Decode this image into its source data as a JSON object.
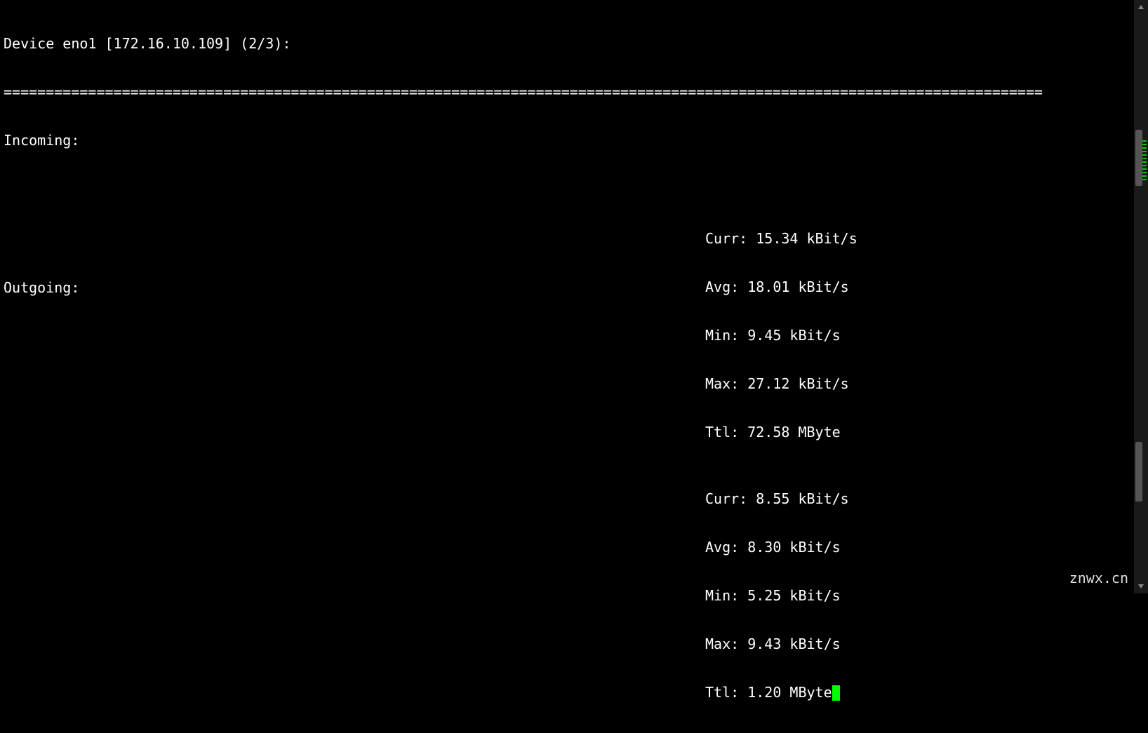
{
  "header": {
    "line": "Device eno1 [172.16.10.109] (2/3):",
    "divider": "==================================================================================================================================="
  },
  "incoming": {
    "label": "Incoming:",
    "stats": {
      "curr": "Curr: 15.34 kBit/s",
      "avg": "Avg: 18.01 kBit/s",
      "min": "Min: 9.45 kBit/s",
      "max": "Max: 27.12 kBit/s",
      "ttl": "Ttl: 72.58 MByte"
    }
  },
  "outgoing": {
    "label": "Outgoing:",
    "stats": {
      "curr": "Curr: 8.55 kBit/s",
      "avg": "Avg: 8.30 kBit/s",
      "min": "Min: 5.25 kBit/s",
      "max": "Max: 9.43 kBit/s",
      "ttl": "Ttl: 1.20 MByte"
    }
  },
  "watermark": "znwx.cn"
}
